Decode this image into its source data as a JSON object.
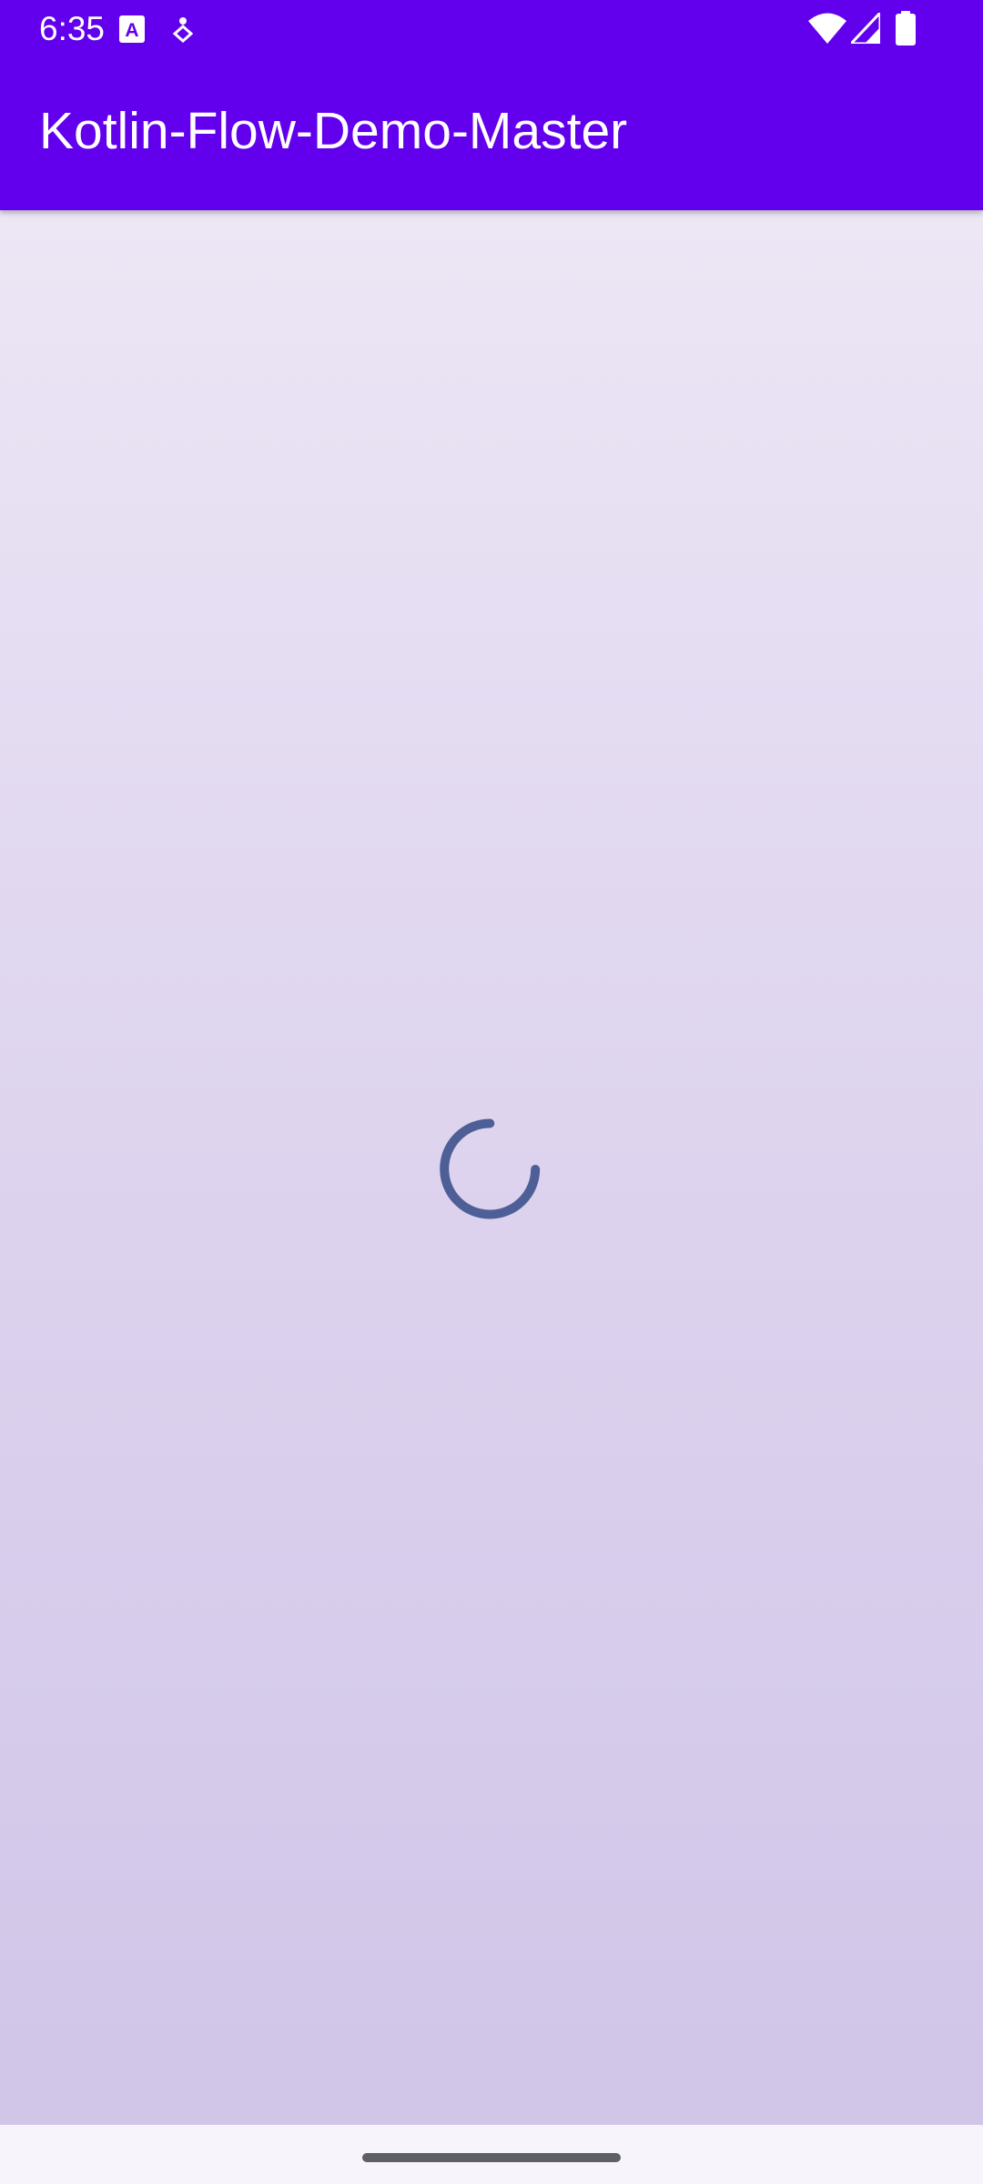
{
  "status_bar": {
    "time": "6:35",
    "icons_left": [
      "a-notification-icon",
      "accessibility-notification-icon"
    ],
    "icons_right": [
      "wifi-icon",
      "cellular-signal-icon",
      "battery-icon"
    ]
  },
  "app_bar": {
    "title": "Kotlin-Flow-Demo-Master"
  },
  "main": {
    "state": "loading",
    "spinner_icon": "progress-spinner-icon"
  },
  "colors": {
    "primary": "#6200ee",
    "spinner": "#4d5f96",
    "background_top": "#ece6f5",
    "background_bottom": "#d1c5e8"
  }
}
